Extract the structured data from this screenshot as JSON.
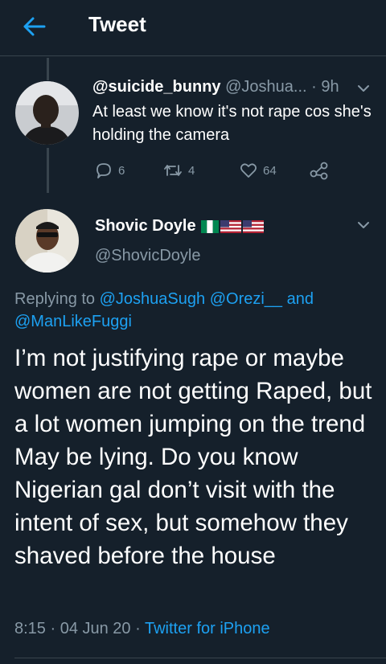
{
  "header": {
    "title": "Tweet",
    "back_icon": "arrow-left-icon",
    "accent": "#1da1f2"
  },
  "colors": {
    "background": "#15202b",
    "secondary_text": "#8899a6",
    "link": "#1da1f2",
    "divider": "#38444d"
  },
  "parent_tweet": {
    "username": "@suicide_bunny",
    "handle": "@Joshua...",
    "separator": "·",
    "time": "9h",
    "text": "At least we know it's not rape cos she's holding the camera",
    "replies": "6",
    "retweets": "4",
    "likes": "64"
  },
  "main_tweet": {
    "display_name": "Shovic Doyle",
    "flags": [
      "nigeria-flag",
      "usa-flag",
      "usa-flag"
    ],
    "handle": "@ShovicDoyle",
    "replying_prefix": "Replying to",
    "replying_user_1": "@JoshuaSugh",
    "replying_user_2": "@Orezi__",
    "replying_and": "and",
    "replying_user_3": "@ManLikeFuggi",
    "body": "I’m not justifying rape or maybe women are not getting Raped,  but a lot women jumping on the trend May be lying. Do you know Nigerian gal don’t visit with the intent of sex, but somehow they shaved before the house",
    "timestamp": "8:15 · 04 Jun 20 ·",
    "source": "Twitter for iPhone"
  }
}
